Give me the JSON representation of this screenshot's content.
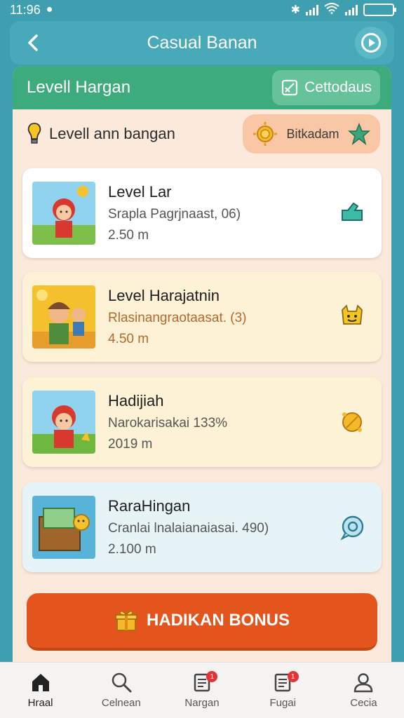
{
  "status": {
    "time": "11:96"
  },
  "header": {
    "title": "Casual Banan"
  },
  "panel": {
    "title": "Levell Hargan",
    "category_label": "Cettodaus",
    "subtitle": "Levell ann bangan",
    "bonus_pill_label": "Bitkadam"
  },
  "games": [
    {
      "title": "Level Lar",
      "subtitle": "Srapla Pagrjnaast, 06)",
      "size": "2.50 m",
      "icon": "leaf-icon",
      "bg": "#ffffff"
    },
    {
      "title": "Level Harajatnin",
      "subtitle": "Rlasinangraotaasat. (3)",
      "size": "4.50 m",
      "icon": "smile-face-icon",
      "bg": "#fdf1d6"
    },
    {
      "title": "Hadijiah",
      "subtitle": "Narokarisakai 133%",
      "size": "2019 m",
      "icon": "coin-icon",
      "bg": "#fdf1d6"
    },
    {
      "title": "RaraHingan",
      "subtitle": "Cranlai lnalaianaiasai. 490)",
      "size": "2.100 m",
      "icon": "chat-bubble-icon",
      "bg": "#e6f4f7"
    }
  ],
  "bonus_button": {
    "label": "HADIKAN BONUS"
  },
  "nav": [
    {
      "label": "Hraal",
      "icon": "home-icon",
      "active": true
    },
    {
      "label": "Celnean",
      "icon": "search-icon",
      "active": false
    },
    {
      "label": "Nargan",
      "icon": "document-icon",
      "badge": "1",
      "active": false
    },
    {
      "label": "Fugai",
      "icon": "document-icon",
      "badge": "1",
      "active": false
    },
    {
      "label": "Cecia",
      "icon": "user-icon",
      "active": false
    }
  ]
}
